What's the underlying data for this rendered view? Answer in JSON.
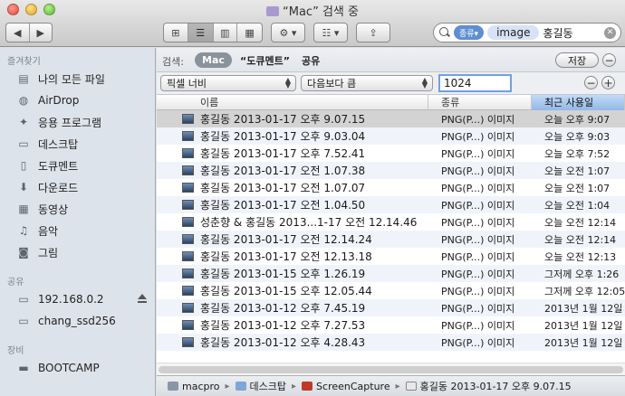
{
  "window": {
    "title": "“Mac” 검색 중"
  },
  "toolbar": {
    "back_label": "◀",
    "forward_label": "▶",
    "view_icon": "icon-view-icon",
    "view_list": "list-view-icon",
    "view_column": "column-view-icon",
    "view_coverflow": "coverflow-view-icon",
    "action_label": "⚙ ▾",
    "arrange_label": "☷ ▾",
    "share_label": "⇪"
  },
  "search": {
    "kind_token": "종류▾",
    "image_token": "image",
    "query": "홍길동"
  },
  "sidebar": {
    "favorites_label": "즐겨찾기",
    "favorites": [
      {
        "label": "나의 모든 파일",
        "icon": "all-files-icon"
      },
      {
        "label": "AirDrop",
        "icon": "airdrop-icon"
      },
      {
        "label": "응용 프로그램",
        "icon": "applications-icon"
      },
      {
        "label": "데스크탑",
        "icon": "desktop-icon"
      },
      {
        "label": "도큐멘트",
        "icon": "documents-icon"
      },
      {
        "label": "다운로드",
        "icon": "downloads-icon"
      },
      {
        "label": "동영상",
        "icon": "movies-icon"
      },
      {
        "label": "음악",
        "icon": "music-icon"
      },
      {
        "label": "그림",
        "icon": "pictures-icon"
      }
    ],
    "shared_label": "공유",
    "shared": [
      {
        "label": "192.168.0.2",
        "icon": "server-icon"
      },
      {
        "label": "chang_ssd256",
        "icon": "server-icon"
      }
    ],
    "devices_label": "장비",
    "devices": [
      {
        "label": "BOOTCAMP",
        "icon": "disk-icon"
      }
    ]
  },
  "scope": {
    "label": "검색:",
    "options": [
      "Mac",
      "“도큐멘트”",
      "공유"
    ],
    "save_label": "저장",
    "remove_label": "−"
  },
  "rule": {
    "attribute": "픽셀 너비",
    "operator": "다음보다 큼",
    "value": "1024",
    "remove_label": "−",
    "add_label": "+"
  },
  "columns": {
    "name": "이름",
    "kind": "종류",
    "date": "최근 사용일"
  },
  "files": [
    {
      "name": "홍길동 2013-01-17 오후 9.07.15",
      "kind": "PNG(P...) 이미지",
      "date": "오늘 오후 9:07"
    },
    {
      "name": "홍길동 2013-01-17 오후 9.03.04",
      "kind": "PNG(P...) 이미지",
      "date": "오늘 오후 9:03"
    },
    {
      "name": "홍길동 2013-01-17 오후 7.52.41",
      "kind": "PNG(P...) 이미지",
      "date": "오늘 오후 7:52"
    },
    {
      "name": "홍길동 2013-01-17 오전 1.07.38",
      "kind": "PNG(P...) 이미지",
      "date": "오늘 오전 1:07"
    },
    {
      "name": "홍길동 2013-01-17 오전 1.07.07",
      "kind": "PNG(P...) 이미지",
      "date": "오늘 오전 1:07"
    },
    {
      "name": "홍길동 2013-01-17 오전 1.04.50",
      "kind": "PNG(P...) 이미지",
      "date": "오늘 오전 1:04"
    },
    {
      "name": "성춘향 & 홍길동 2013...1-17 오전 12.14.46",
      "kind": "PNG(P...) 이미지",
      "date": "오늘 오전 12:14"
    },
    {
      "name": "홍길동 2013-01-17 오전 12.14.24",
      "kind": "PNG(P...) 이미지",
      "date": "오늘 오전 12:14"
    },
    {
      "name": "홍길동 2013-01-17 오전 12.13.18",
      "kind": "PNG(P...) 이미지",
      "date": "오늘 오전 12:13"
    },
    {
      "name": "홍길동 2013-01-15 오후 1.26.19",
      "kind": "PNG(P...) 이미지",
      "date": "그저께 오후 1:26"
    },
    {
      "name": "홍길동 2013-01-15 오후 12.05.44",
      "kind": "PNG(P...) 이미지",
      "date": "그저께 오후 12:05"
    },
    {
      "name": "홍길동 2013-01-12 오후 7.45.19",
      "kind": "PNG(P...) 이미지",
      "date": "2013년 1월 12일"
    },
    {
      "name": "홍길동 2013-01-12 오후 7.27.53",
      "kind": "PNG(P...) 이미지",
      "date": "2013년 1월 12일"
    },
    {
      "name": "홍길동 2013-01-12 오후 4.28.43",
      "kind": "PNG(P...) 이미지",
      "date": "2013년 1월 12일"
    }
  ],
  "pathbar": [
    "macpro",
    "데스크탑",
    "ScreenCapture",
    "홍길동 2013-01-17 오후 9.07.15"
  ]
}
